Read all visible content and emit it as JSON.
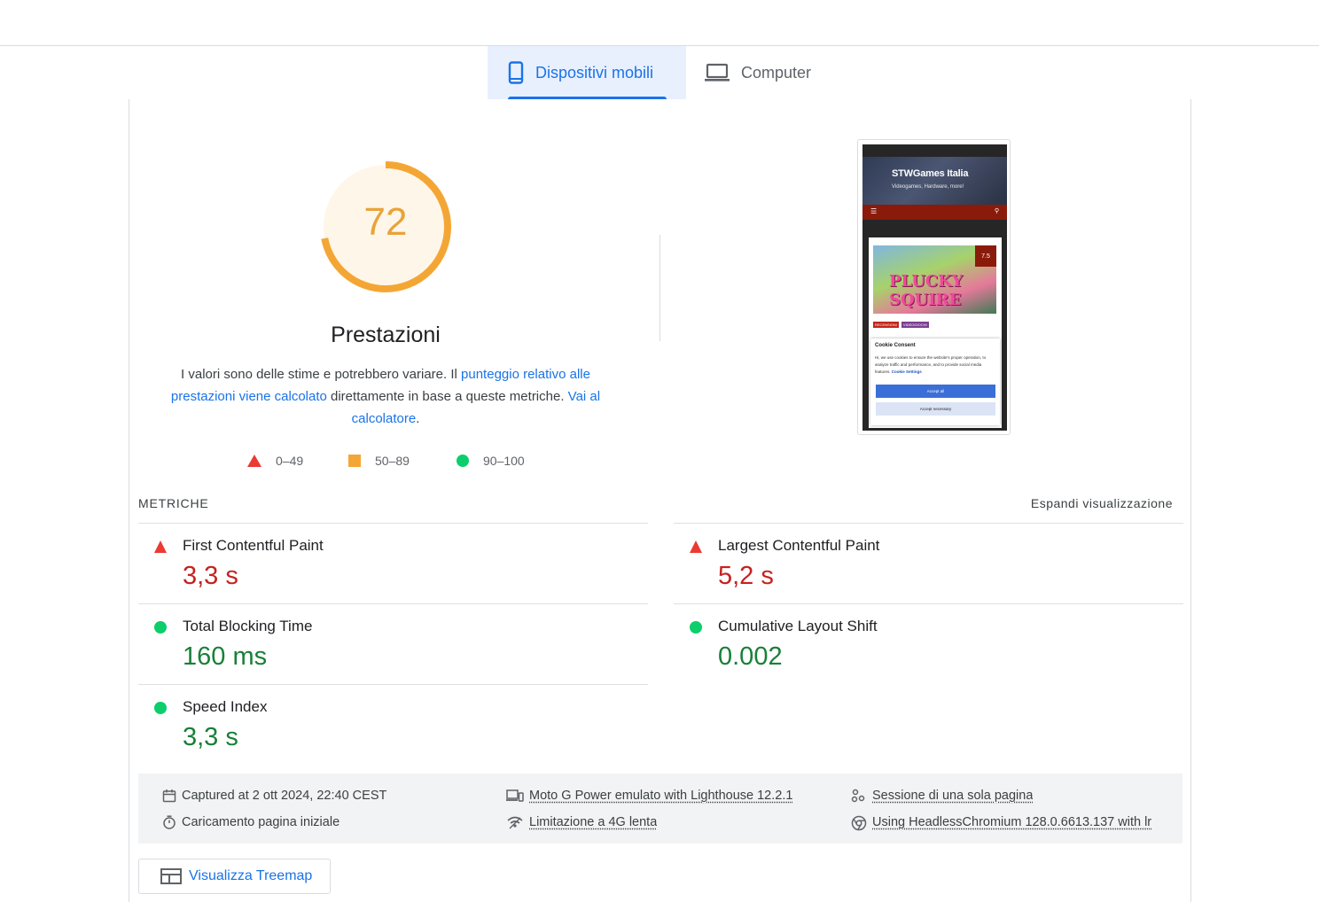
{
  "tabs": {
    "mobile_label": "Dispositivi mobili",
    "desktop_label": "Computer",
    "active": "mobile"
  },
  "performance": {
    "score": "72",
    "score_value": 72,
    "title": "Prestazioni",
    "desc_part1": "I valori sono delle stime e potrebbero variare. Il ",
    "desc_link1": "punteggio relativo alle prestazioni viene calcolato",
    "desc_part2": " direttamente in base a queste metriche. ",
    "desc_link2": "Vai al calcolatore",
    "desc_part3": ".",
    "gauge_color": "#f4a634",
    "gauge_bg": "#fef6e9"
  },
  "legend": [
    {
      "range": "0–49",
      "shape": "triangle",
      "color": "#eb3a32"
    },
    {
      "range": "50–89",
      "shape": "square",
      "color": "#f4a634"
    },
    {
      "range": "90–100",
      "shape": "circle",
      "color": "#0cce6b"
    }
  ],
  "screenshot": {
    "site_title": "STWGames Italia",
    "site_subtitle": "Videogames, Hardware, more!",
    "badge": "7.5",
    "game_logo": "PLUCKY SQUIRE",
    "tags": [
      "RECENSIONI",
      "VIDEOGIOCHI"
    ],
    "cookie_title": "Cookie Consent",
    "cookie_text": "Hi, we use cookies to ensure the website's proper operation, to analyze traffic and performance, and to provide social media features.",
    "cookie_link": "Cookie Settings",
    "accept_all": "Accept all",
    "accept_necessary": "Accept necessary"
  },
  "metrics": {
    "heading": "METRICHE",
    "expand": "Espandi visualizzazione",
    "items": [
      {
        "name": "First Contentful Paint",
        "value": "3,3 s",
        "status": "poor"
      },
      {
        "name": "Largest Contentful Paint",
        "value": "5,2 s",
        "status": "poor"
      },
      {
        "name": "Total Blocking Time",
        "value": "160 ms",
        "status": "good"
      },
      {
        "name": "Cumulative Layout Shift",
        "value": "0.002",
        "status": "good"
      },
      {
        "name": "Speed Index",
        "value": "3,3 s",
        "status": "good"
      }
    ]
  },
  "runtime": {
    "captured": "Captured at 2 ott 2024, 22:40 CEST",
    "load": "Caricamento pagina iniziale",
    "device": "Moto G Power emulato with Lighthouse 12.2.1",
    "throttling": "Limitazione a 4G lenta",
    "session": "Sessione di una sola pagina",
    "browser": "Using HeadlessChromium 128.0.6613.137 with lr"
  },
  "treemap": {
    "label": "Visualizza Treemap"
  }
}
